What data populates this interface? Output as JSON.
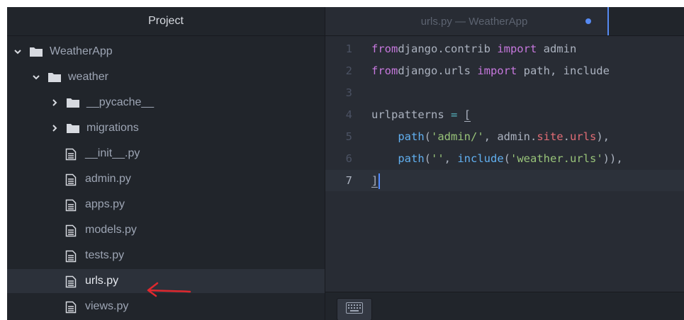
{
  "sidebar": {
    "title": "Project",
    "items": [
      {
        "label": "WeatherApp",
        "type": "folder",
        "expanded": true,
        "depth": 0,
        "icon": "folder-icon"
      },
      {
        "label": "weather",
        "type": "folder",
        "expanded": true,
        "depth": 1,
        "icon": "folder-icon"
      },
      {
        "label": "__pycache__",
        "type": "folder",
        "expanded": false,
        "depth": 2,
        "icon": "folder-icon"
      },
      {
        "label": "migrations",
        "type": "folder",
        "expanded": false,
        "depth": 2,
        "icon": "folder-icon"
      },
      {
        "label": "__init__.py",
        "type": "file",
        "depth": 2,
        "icon": "file-text-icon"
      },
      {
        "label": "admin.py",
        "type": "file",
        "depth": 2,
        "icon": "file-text-icon"
      },
      {
        "label": "apps.py",
        "type": "file",
        "depth": 2,
        "icon": "file-text-icon"
      },
      {
        "label": "models.py",
        "type": "file",
        "depth": 2,
        "icon": "file-text-icon"
      },
      {
        "label": "tests.py",
        "type": "file",
        "depth": 2,
        "icon": "file-text-icon"
      },
      {
        "label": "urls.py",
        "type": "file",
        "depth": 2,
        "icon": "file-text-icon",
        "selected": true
      },
      {
        "label": "views.py",
        "type": "file",
        "depth": 2,
        "icon": "file-text-icon"
      }
    ]
  },
  "editor": {
    "tab": {
      "title": "urls.py — WeatherApp",
      "modified": true
    },
    "lines": [
      {
        "num": "1",
        "tokens": [
          [
            "kw",
            "from"
          ],
          [
            "",
            "django.contrib "
          ],
          [
            "kw",
            "import"
          ],
          [
            "",
            " admin"
          ]
        ]
      },
      {
        "num": "2",
        "tokens": [
          [
            "kw",
            "from"
          ],
          [
            "",
            "django.urls "
          ],
          [
            "kw",
            "import"
          ],
          [
            "",
            " path, include"
          ]
        ]
      },
      {
        "num": "3",
        "tokens": []
      },
      {
        "num": "4",
        "tokens": [
          [
            "",
            "urlpatterns "
          ],
          [
            "op",
            "="
          ],
          [
            "",
            " "
          ],
          [
            "match",
            "["
          ]
        ]
      },
      {
        "num": "5",
        "tokens": [
          [
            "",
            "    "
          ],
          [
            "fn",
            "path"
          ],
          [
            "",
            "("
          ],
          [
            "str",
            "'admin/'"
          ],
          [
            "",
            ", admin."
          ],
          [
            "prop",
            "site"
          ],
          [
            "",
            "."
          ],
          [
            "prop",
            "urls"
          ],
          [
            "",
            "),"
          ]
        ]
      },
      {
        "num": "6",
        "tokens": [
          [
            "",
            "    "
          ],
          [
            "fn",
            "path"
          ],
          [
            "",
            "("
          ],
          [
            "str",
            "''"
          ],
          [
            "",
            ", "
          ],
          [
            "fn",
            "include"
          ],
          [
            "",
            "("
          ],
          [
            "str",
            "'weather.urls'"
          ],
          [
            "",
            ")),"
          ]
        ]
      },
      {
        "num": "7",
        "tokens": [
          [
            "match",
            "]"
          ],
          [
            "caret",
            ""
          ]
        ],
        "cursor": true
      }
    ]
  },
  "status_bar": {
    "icon": "keyboard-icon"
  },
  "annotation": {
    "icon": "red-arrow-icon",
    "color": "#e0282e"
  },
  "colors": {
    "accent": "#568af2",
    "sidebar_bg": "#21252b",
    "editor_bg": "#282c34"
  }
}
